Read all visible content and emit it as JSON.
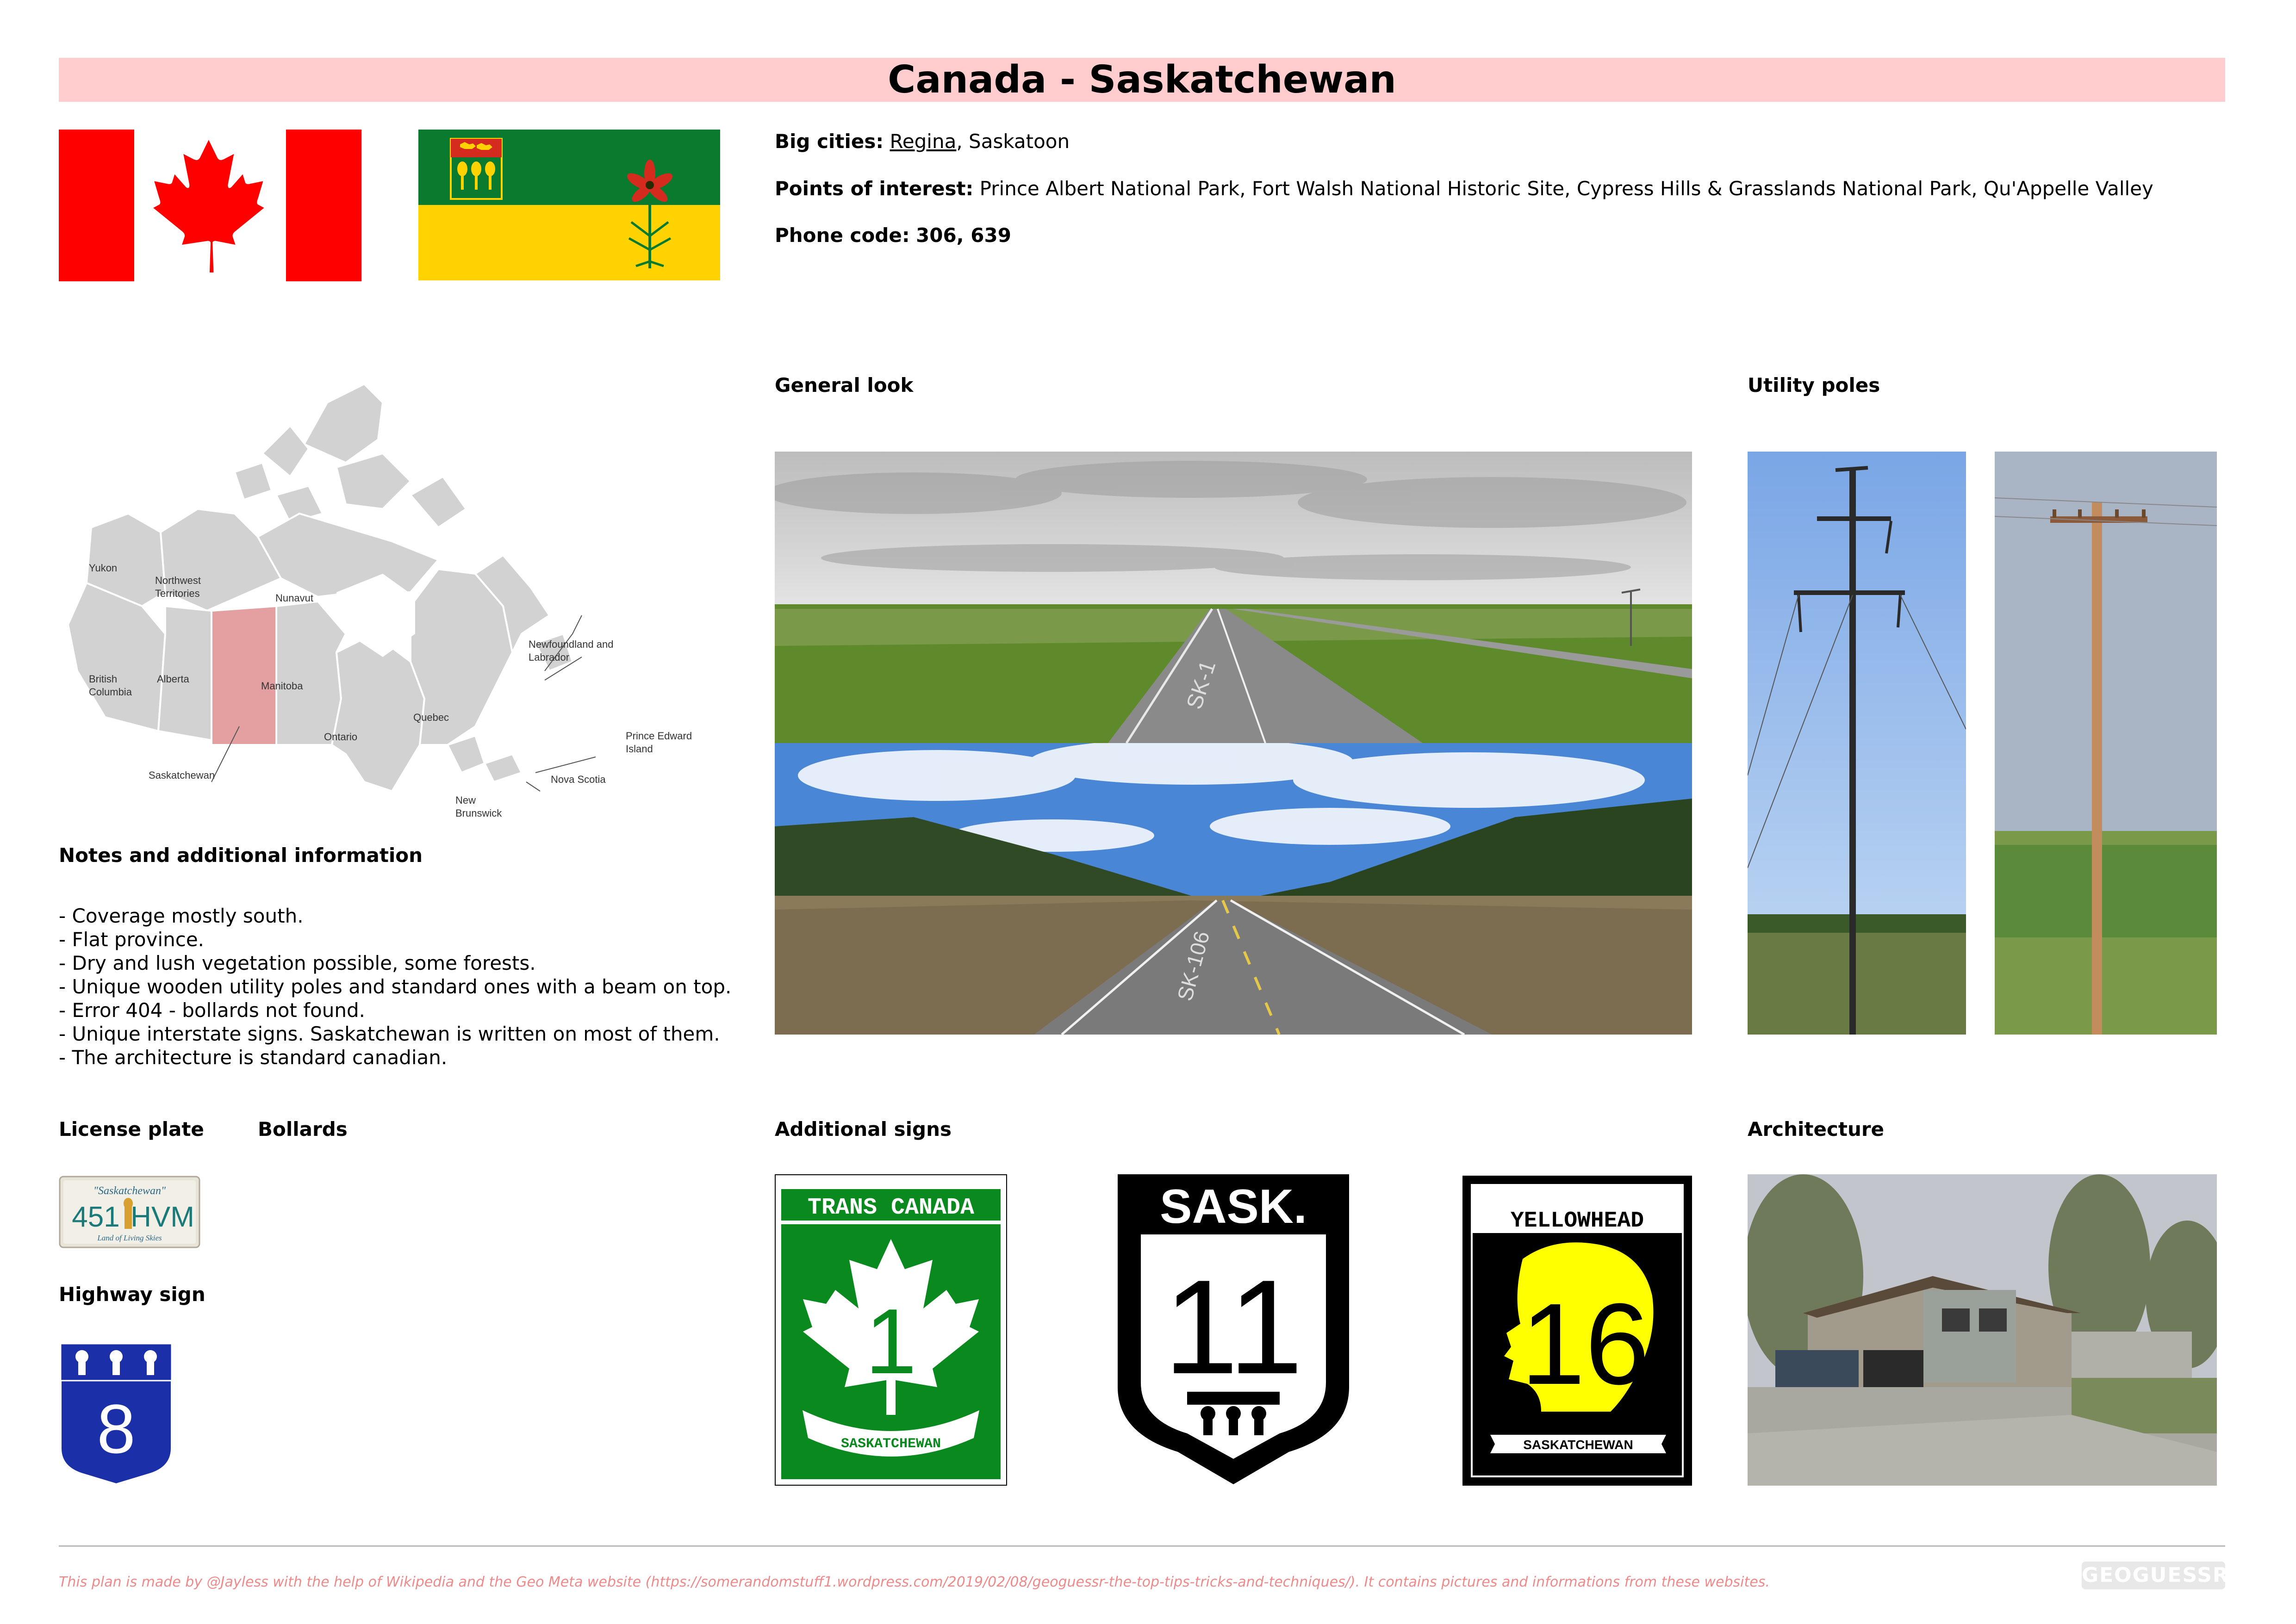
{
  "title": "Canada - Saskatchewan",
  "info": {
    "big_cities_label": "Big cities:",
    "big_city_link": "Regina",
    "big_cities_rest": ", Saskatoon",
    "poi_label": "Points of interest:",
    "poi_value": "Prince Albert National Park, Fort Walsh National Historic Site, Cypress Hills & Grasslands National Park, Qu'Appelle Valley",
    "phone_label": "Phone code:",
    "phone_value": "306, 639"
  },
  "sections": {
    "general_look": "General look",
    "utility_poles": "Utility poles",
    "notes": "Notes and additional information",
    "license_plate": "License plate",
    "bollards": "Bollards",
    "highway_sign": "Highway sign",
    "additional_signs": "Additional signs",
    "architecture": "Architecture"
  },
  "map_labels": {
    "yukon": "Yukon",
    "nwt1": "Northwest",
    "nwt2": "Territories",
    "nunavut": "Nunavut",
    "bc1": "British",
    "bc2": "Columbia",
    "alberta": "Alberta",
    "manitoba": "Manitoba",
    "ontario": "Ontario",
    "quebec": "Quebec",
    "nl1": "Newfoundland and",
    "nl2": "Labrador",
    "pei1": "Prince Edward",
    "pei2": "Island",
    "ns": "Nova Scotia",
    "nb1": "New",
    "nb2": "Brunswick",
    "sask": "Saskatchewan"
  },
  "notes": [
    "- Coverage mostly south.",
    "- Flat province.",
    "- Dry and lush vegetation possible, some forests.",
    "- Unique wooden utility poles and standard ones with a beam on top.",
    "- Error 404 - bollards not found.",
    "- Unique interstate signs. Saskatchewan is written on most of them.",
    "- The architecture is standard canadian."
  ],
  "plate": {
    "top": "\"Saskatchewan\"",
    "number_left": "451",
    "number_right": "HVM",
    "bottom": "Land of Living Skies"
  },
  "highway_sign_number": "8",
  "signs": {
    "trans_canada_top": "TRANS CANADA",
    "trans_canada_num": "1",
    "trans_canada_banner": "SASKATCHEWAN",
    "sask_top": "SASK.",
    "sask_num": "11",
    "yellowhead_top": "YELLOWHEAD",
    "yellowhead_num": "16",
    "yellowhead_bottom": "SASKATCHEWAN"
  },
  "road_labels": {
    "road1": "SK-1",
    "road2": "SK-106"
  },
  "footer": "This plan is made by @Jayless with the help of Wikipedia and the Geo Meta website (https://somerandomstuff1.wordpress.com/2019/02/08/geoguessr-the-top-tips-tricks-and-techniques/). It contains pictures and informations from these websites.",
  "logo": "GEOGUESSR",
  "colors": {
    "title_bg": "#ffcdcd",
    "canada_red": "#ff0000",
    "sask_green": "#0a7a2e",
    "sask_yellow": "#ffd200",
    "highway_blue": "#1a2fa8",
    "footer_text": "#ee8a8a"
  },
  "icons": [
    "maple-leaf-icon",
    "prairie-lily-icon",
    "wheat-sheaf-icon"
  ]
}
